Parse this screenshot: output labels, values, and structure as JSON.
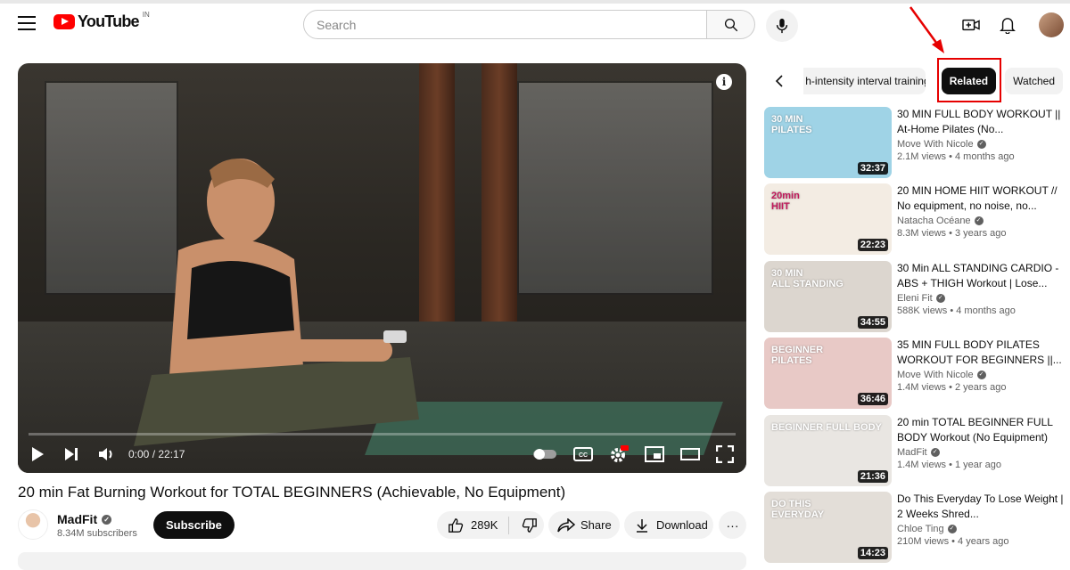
{
  "header": {
    "logo_text": "YouTube",
    "logo_country": "IN",
    "search_placeholder": "Search"
  },
  "player": {
    "time": "0:00 / 22:17",
    "info_glyph": "i",
    "progress": 0.0
  },
  "video": {
    "title": "20 min Fat Burning Workout for TOTAL BEGINNERS (Achievable, No Equipment)",
    "channel": "MadFit",
    "subscribers": "8.34M subscribers",
    "subscribe_label": "Subscribe",
    "likes": "289K",
    "share_label": "Share",
    "download_label": "Download",
    "more_glyph": "···"
  },
  "chips": {
    "items": [
      {
        "label": "h-intensity interval training"
      },
      {
        "label": "Related"
      },
      {
        "label": "Watched"
      }
    ]
  },
  "recommendations": [
    {
      "title": "30 MIN FULL BODY WORKOUT || At-Home Pilates (No...",
      "channel": "Move With Nicole",
      "views": "2.1M views",
      "age": "4 months ago",
      "duration": "32:37",
      "thumb_text": "30 MIN\nPILATES",
      "thumb_color": "#9fd3e6"
    },
    {
      "title": "20 MIN HOME HIIT WORKOUT // No equipment, no noise, no...",
      "channel": "Natacha Océane",
      "views": "8.3M views",
      "age": "3 years ago",
      "duration": "22:23",
      "thumb_text": "20min\nHIIT",
      "thumb_color": "#f3ece3"
    },
    {
      "title": "30 Min ALL STANDING CARDIO - ABS + THIGH Workout | Lose...",
      "channel": "Eleni Fit",
      "views": "588K views",
      "age": "4 months ago",
      "duration": "34:55",
      "thumb_text": "30 MIN\nALL STANDING",
      "thumb_color": "#dcd6cf"
    },
    {
      "title": "35 MIN FULL BODY PILATES WORKOUT FOR BEGINNERS ||...",
      "channel": "Move With Nicole",
      "views": "1.4M views",
      "age": "2 years ago",
      "duration": "36:46",
      "thumb_text": "BEGINNER\nPILATES",
      "thumb_color": "#e8c9c6"
    },
    {
      "title": "20 min TOTAL BEGINNER FULL BODY Workout (No Equipment)",
      "channel": "MadFit",
      "views": "1.4M views",
      "age": "1 year ago",
      "duration": "21:36",
      "thumb_text": "BEGINNER FULL BODY",
      "thumb_color": "#e9e6e2"
    },
    {
      "title": "Do This Everyday To Lose Weight | 2 Weeks Shred...",
      "channel": "Chloe Ting",
      "views": "210M views",
      "age": "4 years ago",
      "duration": "14:23",
      "thumb_text": "DO THIS\nEVERYDAY",
      "thumb_color": "#e3ded8"
    }
  ],
  "colors": {
    "brand": "#ff0000",
    "highlight": "#e60000",
    "chip_active": "#0f0f0f"
  }
}
